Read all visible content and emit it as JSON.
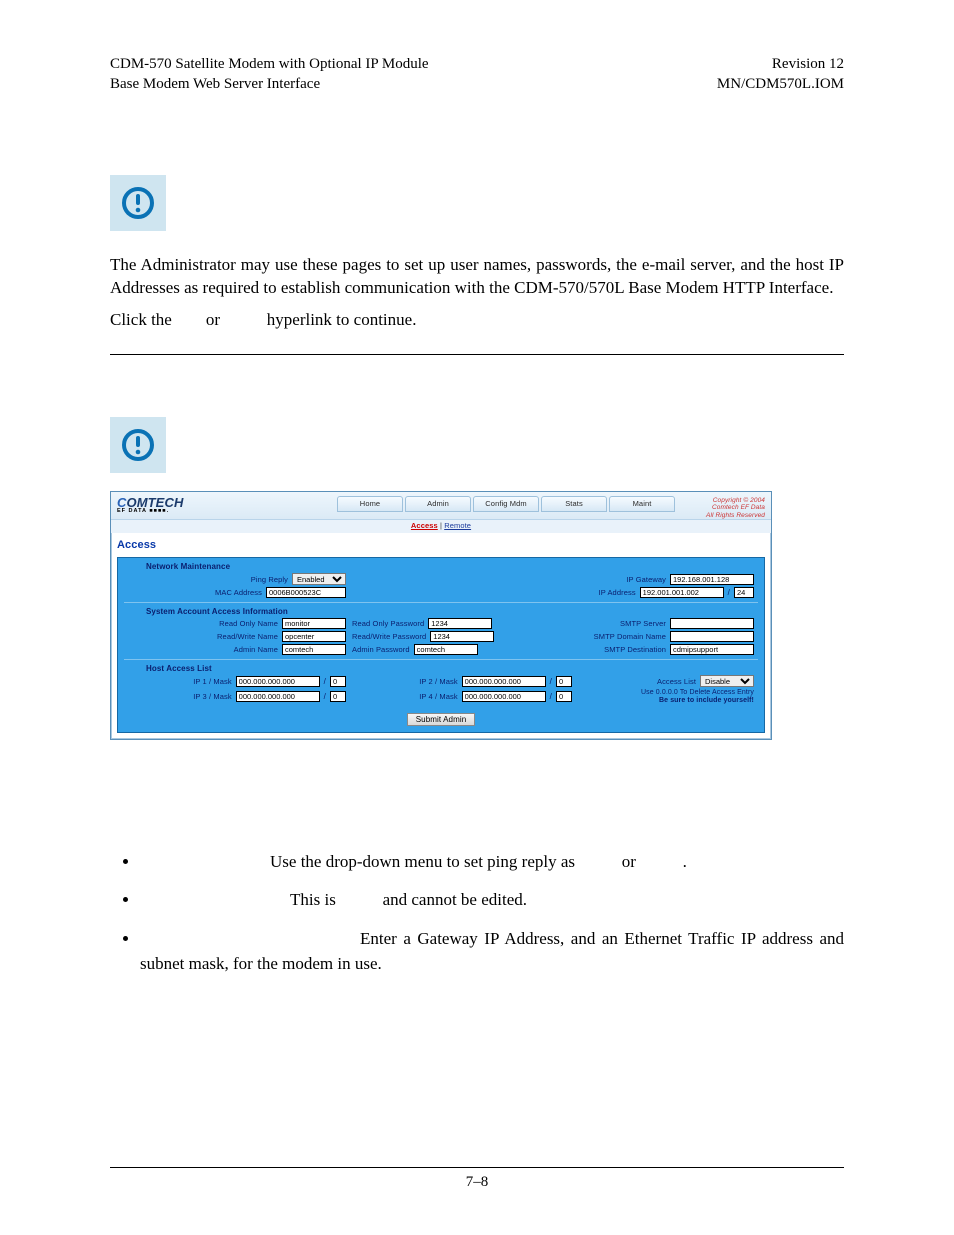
{
  "header": {
    "leftLine1": "CDM-570 Satellite Modem with Optional IP Module",
    "leftLine2": "Base Modem Web Server Interface",
    "rightLine1": "Revision 12",
    "rightLine2": "MN/CDM570L.IOM"
  },
  "section1": {
    "para1": "The Administrator may use these pages to set up user names, passwords, the e-mail server, and the host IP Addresses as required to establish communication with the CDM-570/570L Base Modem HTTP Interface.",
    "para2a": "Click the",
    "para2b": "or",
    "para2c": "hyperlink to continue."
  },
  "app": {
    "brandSub": "EF DATA ■■■■.",
    "tabs": [
      "Home",
      "Admin",
      "Config Mdm",
      "Stats",
      "Maint"
    ],
    "copyright": [
      "Copyright © 2004",
      "Comtech EF Data",
      "All Rights Reserved"
    ],
    "subnav": [
      "Access",
      "Remote"
    ],
    "pageTitle": "Access",
    "network": {
      "title": "Network Maintenance",
      "pingReply": {
        "label": "Ping Reply",
        "value": "Enabled"
      },
      "mac": {
        "label": "MAC Address",
        "value": "0006B000523C"
      },
      "ipGateway": {
        "label": "IP Gateway",
        "value": "192.168.001.128"
      },
      "ipAddress": {
        "label": "IP Address",
        "value": "192.001.001.002",
        "mask": "24"
      }
    },
    "account": {
      "title": "System Account Access Information",
      "rows": [
        {
          "nameLabel": "Read Only Name",
          "nameValue": "monitor",
          "pwLabel": "Read Only Password",
          "pwValue": "1234",
          "rightLabel": "SMTP Server",
          "rightValue": ""
        },
        {
          "nameLabel": "Read/Write Name",
          "nameValue": "opcenter",
          "pwLabel": "Read/Write Password",
          "pwValue": "1234",
          "rightLabel": "SMTP Domain Name",
          "rightValue": ""
        },
        {
          "nameLabel": "Admin Name",
          "nameValue": "comtech",
          "pwLabel": "Admin Password",
          "pwValue": "comtech",
          "rightLabel": "SMTP Destination",
          "rightValue": "cdmipsupport"
        }
      ]
    },
    "host": {
      "title": "Host Access List",
      "ips": [
        {
          "label": "IP 1 / Mask",
          "value": "000.000.000.000",
          "mask": "0"
        },
        {
          "label": "IP 2 / Mask",
          "value": "000.000.000.000",
          "mask": "0"
        },
        {
          "label": "IP 3 / Mask",
          "value": "000.000.000.000",
          "mask": "0"
        },
        {
          "label": "IP 4 / Mask",
          "value": "000.000.000.000",
          "mask": "0"
        }
      ],
      "accessList": {
        "label": "Access List",
        "value": "Disable"
      },
      "note1": "Use 0.0.0.0 To Delete Access Entry",
      "note2": "Be sure to include yourself!"
    },
    "submitLabel": "Submit Admin"
  },
  "bullets": [
    {
      "a": "Use the drop-down menu to set ping reply as",
      "b": "or",
      "c": "."
    },
    {
      "a": "This is",
      "b": "and cannot be edited."
    },
    {
      "a": "Enter a Gateway IP Address, and an Ethernet Traffic IP address",
      "b": "and subnet mask, for the modem in use."
    }
  ],
  "footer": {
    "pageNumber": "7–8"
  }
}
